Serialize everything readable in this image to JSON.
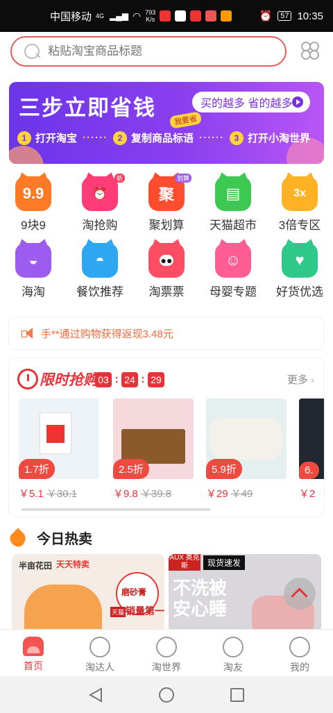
{
  "status": {
    "carrier": "中国移动",
    "net": "4G",
    "speed_value": "793",
    "speed_unit": "K/s",
    "battery": "57",
    "time": "10:35"
  },
  "search": {
    "placeholder": "粘贴淘宝商品标题"
  },
  "banner": {
    "title": "三步立即省钱",
    "badge": "我要省",
    "pill": "买的越多 省的越多",
    "steps": [
      {
        "num": "1",
        "label": "打开淘宝"
      },
      {
        "num": "2",
        "label": "复制商品标语"
      },
      {
        "num": "3",
        "label": "打开小淘世界"
      }
    ]
  },
  "categories": [
    {
      "label": "9块9",
      "glyph": "9.9",
      "color": "#ff7a26",
      "tag": ""
    },
    {
      "label": "淘抢购",
      "glyph": "⏰",
      "color": "#ff3c78",
      "tag": "新"
    },
    {
      "label": "聚划算",
      "glyph": "聚",
      "color": "#ff4d2e",
      "tag": "划算"
    },
    {
      "label": "天猫超市",
      "glyph": "▤",
      "color": "#3cc853",
      "tag": ""
    },
    {
      "label": "3倍专区",
      "glyph": "3x",
      "color": "#ffb224",
      "tag": ""
    },
    {
      "label": "海淘",
      "glyph": "◒",
      "color": "#9c5cf0",
      "tag": ""
    },
    {
      "label": "餐饮推荐",
      "glyph": "◓",
      "color": "#2ea7f2",
      "tag": ""
    },
    {
      "label": "淘票票",
      "glyph": "●●",
      "color": "#ff4d64",
      "tag": ""
    },
    {
      "label": "母婴专题",
      "glyph": "☺",
      "color": "#ff5d94",
      "tag": ""
    },
    {
      "label": "好货优选",
      "glyph": "♥",
      "color": "#2ec98a",
      "tag": ""
    }
  ],
  "notice": {
    "text": "手**通过购物获得返现3.48元"
  },
  "flash": {
    "logo": "限时抢购",
    "timer": [
      "03",
      "24",
      "29"
    ],
    "more": "更多",
    "products": [
      {
        "discount": "1.7折",
        "price": "￥5.1",
        "orig": "￥30.1",
        "bg": "#eef3f8"
      },
      {
        "discount": "2.5折",
        "price": "￥9.8",
        "orig": "￥39.8",
        "bg": "#f6d9dc"
      },
      {
        "discount": "5.9折",
        "price": "￥29",
        "orig": "￥49",
        "bg": "#e5eff0"
      },
      {
        "discount": "6.",
        "price": "￥2",
        "orig": "",
        "bg": "#222831"
      }
    ]
  },
  "hot": {
    "title": "今日热卖",
    "cards": [
      {
        "brand": "半亩花田",
        "tag": "天天特卖",
        "line1": "磨砂膏",
        "line2": "销量第一",
        "sub": "天猫"
      },
      {
        "brand": "AUX 奥克斯",
        "tag": "现货速发",
        "line1": "不洗被",
        "line2": "安心睡",
        "sub": ""
      }
    ]
  },
  "tabs": [
    {
      "label": "首页",
      "icon": "home-icon",
      "active": true
    },
    {
      "label": "淘达人",
      "icon": "expert-icon",
      "active": false
    },
    {
      "label": "淘世界",
      "icon": "world-icon",
      "active": false
    },
    {
      "label": "淘友",
      "icon": "friends-icon",
      "active": false
    },
    {
      "label": "我的",
      "icon": "profile-icon",
      "active": false
    }
  ]
}
